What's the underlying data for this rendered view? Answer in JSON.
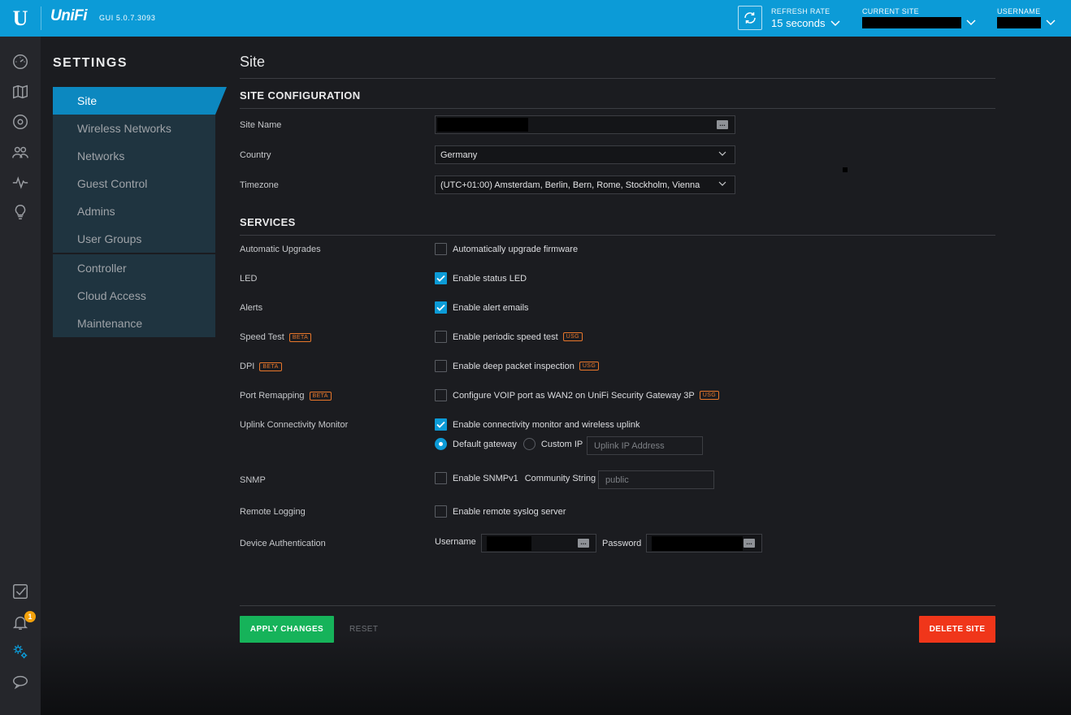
{
  "topbar": {
    "brand": "UniFi",
    "gui_version": "GUI 5.0.7.3093",
    "refresh_label": "REFRESH RATE",
    "refresh_value": "15 seconds",
    "site_label": "CURRENT SITE",
    "user_label": "USERNAME",
    "accent": "#0c9bd7"
  },
  "rail": {
    "icons": [
      "dashboard-icon",
      "map-icon",
      "devices-icon",
      "clients-icon",
      "statistics-icon",
      "insights-icon",
      "events-icon",
      "alerts-icon",
      "settings-icon",
      "chat-icon"
    ],
    "alert_count": "1"
  },
  "settings": {
    "title": "SETTINGS",
    "items": [
      {
        "label": "Site",
        "active": true
      },
      {
        "label": "Wireless Networks"
      },
      {
        "label": "Networks"
      },
      {
        "label": "Guest Control"
      },
      {
        "label": "Admins"
      },
      {
        "label": "User Groups"
      }
    ],
    "items2": [
      {
        "label": "Controller"
      },
      {
        "label": "Cloud Access"
      },
      {
        "label": "Maintenance"
      }
    ]
  },
  "page": {
    "title": "Site",
    "site_config_heading": "SITE CONFIGURATION",
    "services_heading": "SERVICES",
    "site_name_label": "Site Name",
    "country_label": "Country",
    "country_value": "Germany",
    "timezone_label": "Timezone",
    "timezone_value": "(UTC+01:00) Amsterdam, Berlin, Bern, Rome, Stockholm, Vienna",
    "beta_tag": "BETA",
    "usg_tag": "USG",
    "services": {
      "auto_upgrades_label": "Automatic Upgrades",
      "auto_upgrades_text": "Automatically upgrade firmware",
      "led_label": "LED",
      "led_text": "Enable status LED",
      "alerts_label": "Alerts",
      "alerts_text": "Enable alert emails",
      "speedtest_label": "Speed Test",
      "speedtest_text": "Enable periodic speed test",
      "dpi_label": "DPI",
      "dpi_text": "Enable deep packet inspection",
      "portremap_label": "Port Remapping",
      "portremap_text": "Configure VOIP port as WAN2 on UniFi Security Gateway 3P",
      "uplink_label": "Uplink Connectivity Monitor",
      "uplink_text": "Enable connectivity monitor and wireless uplink",
      "default_gateway": "Default gateway",
      "custom_ip": "Custom IP",
      "uplink_placeholder": "Uplink IP Address",
      "snmp_label": "SNMP",
      "snmp_text": "Enable SNMPv1",
      "community_label": "Community String",
      "community_placeholder": "public",
      "remote_logging_label": "Remote Logging",
      "remote_logging_text": "Enable remote syslog server",
      "device_auth_label": "Device Authentication",
      "username_label": "Username",
      "password_label": "Password"
    },
    "apply_label": "APPLY CHANGES",
    "reset_label": "RESET",
    "delete_label": "DELETE SITE"
  }
}
